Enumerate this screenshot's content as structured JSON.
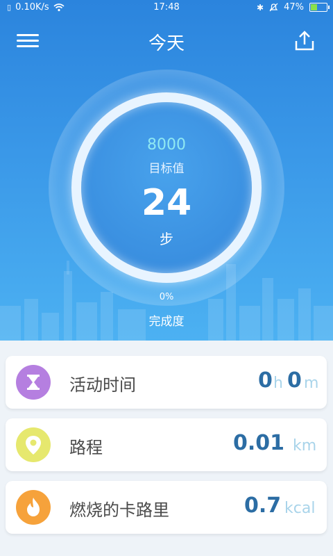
{
  "status_bar": {
    "speed": "0.10K/s",
    "time": "17:48",
    "battery": "47%",
    "battery_level": 0.47,
    "icons": [
      "sim-icon",
      "wifi-icon",
      "bluetooth-icon",
      "alarm-icon",
      "battery-icon"
    ]
  },
  "header": {
    "title": "今天",
    "menu_icon": "menu-icon",
    "share_icon": "share-icon"
  },
  "progress": {
    "goal_value": "8000",
    "goal_label": "目标值",
    "steps": "24",
    "steps_unit": "步",
    "percent": "0%",
    "percent_label": "完成度"
  },
  "stats": {
    "activity": {
      "label": "活动时间",
      "hours": "0",
      "hours_unit": "h",
      "minutes": "0",
      "minutes_unit": "m",
      "icon": "hourglass-icon",
      "color": "#b57fe0"
    },
    "distance": {
      "label": "路程",
      "value": "0.01",
      "unit": "km",
      "icon": "location-pin-icon",
      "color": "#e6e86e"
    },
    "calories": {
      "label": "燃烧的卡路里",
      "value": "0.7",
      "unit": "kcal",
      "icon": "flame-icon",
      "color": "#f6a23b"
    }
  },
  "colors": {
    "accent": "#3a98e8",
    "value_text": "#2c6da4",
    "unit_text": "#a9d4ea"
  }
}
